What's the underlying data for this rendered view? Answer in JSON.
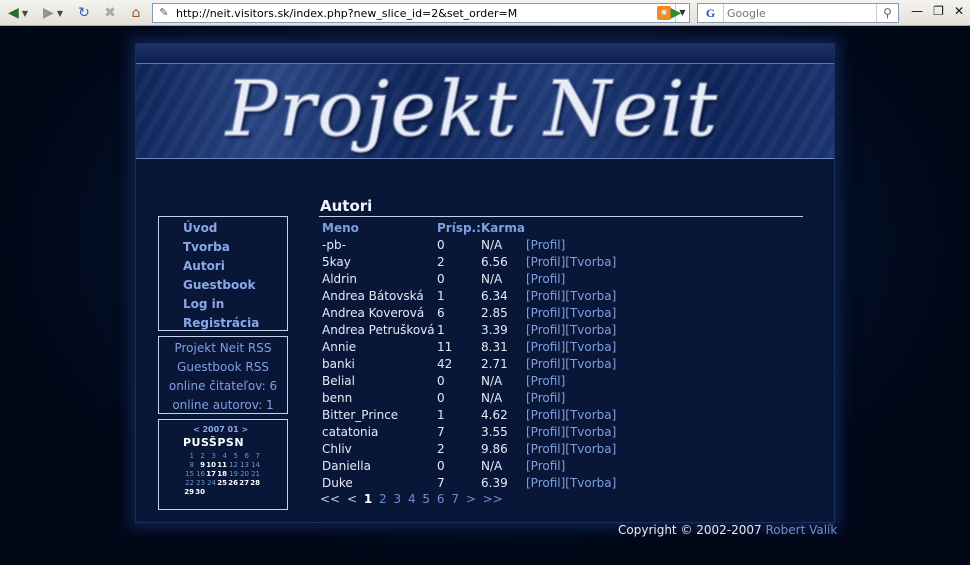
{
  "browser": {
    "url": "http://neit.visitors.sk/index.php?new_slice_id=2&set_order=M",
    "search_placeholder": "Google",
    "search_engine_icon": "G"
  },
  "site": {
    "banner_title": "Projekt  Neit"
  },
  "menu": [
    "Úvod",
    "Tvorba",
    "Autori",
    "Guestbook",
    "Log in",
    "Registrácia"
  ],
  "info": {
    "rss_main": "Projekt Neit RSS",
    "rss_guestbook": "Guestbook RSS",
    "online_readers": "online čitateľov: 6",
    "online_authors": "online autorov: 1"
  },
  "calendar": {
    "header": "< 2007 01 >",
    "days": "PUSŠPSN",
    "weeks": [
      [
        "",
        "1",
        "2",
        "3",
        "4",
        "5",
        "6",
        "7"
      ],
      [
        "",
        "8",
        "9",
        "10",
        "11",
        "12",
        "13",
        "14"
      ],
      [
        "",
        "15",
        "16",
        "17",
        "18",
        "19",
        "20",
        "21"
      ],
      [
        "",
        "22",
        "23",
        "24",
        "25",
        "26",
        "27",
        "28"
      ],
      [
        "",
        "29",
        "30",
        "",
        "",
        "",
        "",
        ""
      ]
    ],
    "highlighted": [
      "9",
      "10",
      "11",
      "17",
      "18",
      "25",
      "26",
      "27",
      "28",
      "29",
      "30"
    ]
  },
  "main": {
    "title": "Autori",
    "columns": [
      "Meno",
      "Prísp.:",
      "Karma"
    ],
    "rows": [
      {
        "name": "-pb-",
        "posts": "0",
        "karma": "N/A",
        "links": "[Profil]"
      },
      {
        "name": "5kay",
        "posts": "2",
        "karma": "6.56",
        "links": "[Profil][Tvorba]"
      },
      {
        "name": "Aldrin",
        "posts": "0",
        "karma": "N/A",
        "links": "[Profil]"
      },
      {
        "name": "Andrea Bátovská",
        "posts": "1",
        "karma": "6.34",
        "links": "[Profil][Tvorba]"
      },
      {
        "name": "Andrea Koverová",
        "posts": "6",
        "karma": "2.85",
        "links": "[Profil][Tvorba]"
      },
      {
        "name": "Andrea Petrušková",
        "posts": "1",
        "karma": "3.39",
        "links": "[Profil][Tvorba]"
      },
      {
        "name": "Annie",
        "posts": "11",
        "karma": "8.31",
        "links": "[Profil][Tvorba]"
      },
      {
        "name": "banki",
        "posts": "42",
        "karma": "2.71",
        "links": "[Profil][Tvorba]"
      },
      {
        "name": "Belial",
        "posts": "0",
        "karma": "N/A",
        "links": "[Profil]"
      },
      {
        "name": "benn",
        "posts": "0",
        "karma": "N/A",
        "links": "[Profil]"
      },
      {
        "name": "Bitter_Prince",
        "posts": "1",
        "karma": "4.62",
        "links": "[Profil][Tvorba]"
      },
      {
        "name": "catatonia",
        "posts": "7",
        "karma": "3.55",
        "links": "[Profil][Tvorba]"
      },
      {
        "name": "Chliv",
        "posts": "2",
        "karma": "9.86",
        "links": "[Profil][Tvorba]"
      },
      {
        "name": "Daniella",
        "posts": "0",
        "karma": "N/A",
        "links": "[Profil]"
      },
      {
        "name": "Duke",
        "posts": "7",
        "karma": "6.39",
        "links": "[Profil][Tvorba]"
      }
    ],
    "pager": {
      "first": "<<",
      "prev": "<",
      "current": "1",
      "pages": [
        "2",
        "3",
        "4",
        "5",
        "6",
        "7"
      ],
      "next": ">",
      "last": ">>"
    }
  },
  "footer": {
    "copyright": "Copyright © 2002-2007",
    "author": "Robert Valík"
  }
}
